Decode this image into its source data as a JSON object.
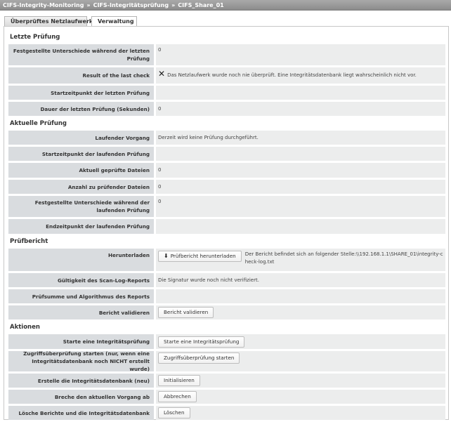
{
  "breadcrumb": {
    "items": [
      "CIFS-Integrity-Monitoring",
      "CIFS-Integritätsprüfung",
      "CIFS_Share_01"
    ],
    "separator": "»"
  },
  "tabs": [
    {
      "label": "Überprüftes Netzlaufwerk",
      "active": false
    },
    {
      "label": "Verwaltung",
      "active": true
    }
  ],
  "sections": {
    "last_check": {
      "title": "Letzte Prüfung",
      "rows": [
        {
          "label": "Festgestellte Unterschiede während der letzten Prüfung",
          "value": "0"
        },
        {
          "label": "Result of the last check",
          "value": "Das Netzlaufwerk wurde noch nie überprüft. Eine Integritätsdatenbank liegt wahrscheinlich nicht vor.",
          "icon": "close-icon"
        },
        {
          "label": "Startzeitpunkt der letzten Prüfung",
          "value": ""
        },
        {
          "label": "Dauer der letzten Prüfung (Sekunden)",
          "value": "0"
        }
      ]
    },
    "current_check": {
      "title": "Aktuelle Prüfung",
      "rows": [
        {
          "label": "Laufender Vorgang",
          "value": "Derzeit wird keine Prüfung durchgeführt."
        },
        {
          "label": "Startzeitpunkt der laufenden Prüfung",
          "value": ""
        },
        {
          "label": "Aktuell geprüfte Dateien",
          "value": "0"
        },
        {
          "label": "Anzahl zu prüfender Dateien",
          "value": "0"
        },
        {
          "label": "Festgestellte Unterschiede während der laufenden Prüfung",
          "value": "0"
        },
        {
          "label": "Endzeitpunkt der laufenden Prüfung",
          "value": ""
        }
      ]
    },
    "report": {
      "title": "Prüfbericht",
      "download": {
        "label": "Herunterladen",
        "button": "Prüfbericht herunterladen",
        "icon": "download-icon",
        "note": "Der Bericht befindet sich an folgender Stelle:\\\\192.168.1.1\\SHARE_01\\integrity-check-log.txt"
      },
      "validity": {
        "label": "Gültigkeit des Scan-Log-Reports",
        "value": "Die Signatur wurde noch nicht verifiziert."
      },
      "checksum": {
        "label": "Prüfsumme und Algorithmus des Reports",
        "value": ""
      },
      "validate": {
        "label": "Bericht validieren",
        "button": "Bericht validieren"
      }
    },
    "actions": {
      "title": "Aktionen",
      "rows": [
        {
          "label": "Starte eine Integritätsprüfung",
          "button": "Starte eine Integritätsprüfung"
        },
        {
          "label": "Zugriffsüberprüfung starten (nur, wenn eine Integritätsdatenbank noch NICHT erstellt wurde)",
          "button": "Zugriffsüberprüfung starten"
        },
        {
          "label": "Erstelle die Integritätsdatenbank (neu)",
          "button": "Initialisieren"
        },
        {
          "label": "Breche den aktuellen Vorgang ab",
          "button": "Abbrechen"
        },
        {
          "label": "Lösche Berichte und die Integritätsdatenbank",
          "button": "Löschen"
        }
      ]
    }
  }
}
